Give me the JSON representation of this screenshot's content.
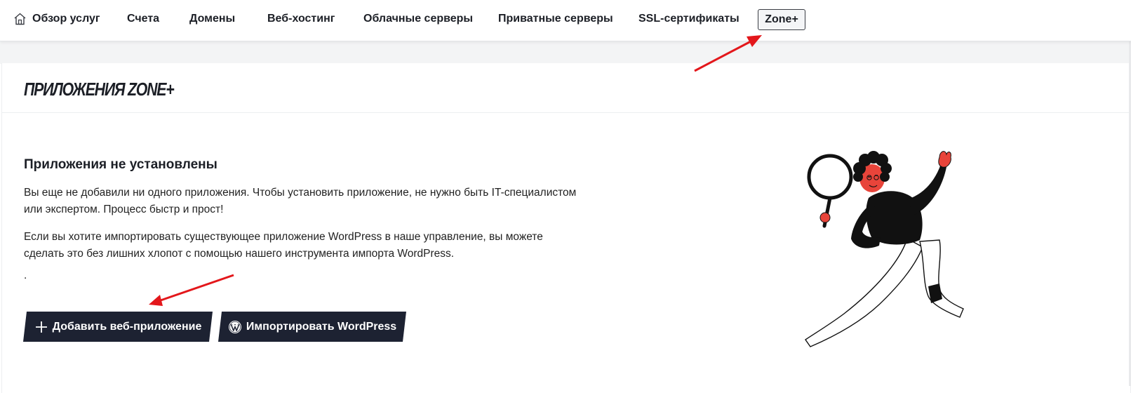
{
  "nav": {
    "items": [
      {
        "label": "Обзор услуг"
      },
      {
        "label": "Счета"
      },
      {
        "label": "Домены"
      },
      {
        "label": "Веб-хостинг"
      },
      {
        "label": "Облачные серверы"
      },
      {
        "label": "Приватные серверы"
      },
      {
        "label": "SSL-сертификаты"
      }
    ],
    "active_label": "Zone+"
  },
  "page": {
    "title": "ПРИЛОЖЕНИЯ ZONE+",
    "empty_title": "Приложения не установлены",
    "paragraph_1": "Вы еще не добавили ни одного приложения. Чтобы установить приложение, не нужно быть IT-специалистом или экспертом. Процесс быстр и прост!",
    "paragraph_2": "Если вы хотите импортировать существующее приложение WordPress в наше управление, вы можете сделать это без лишних хлопот с помощью нашего инструмента импорта WordPress.",
    "dot": "."
  },
  "buttons": {
    "add_label": "Добавить веб-приложение",
    "import_label": "Импортировать WordPress"
  },
  "colors": {
    "button_bg": "#1d2232",
    "arrow": "#e3171b",
    "text": "#1c1f26"
  },
  "icons": {
    "home": "home-icon",
    "plus": "plus-icon",
    "wordpress": "wordpress-icon"
  }
}
